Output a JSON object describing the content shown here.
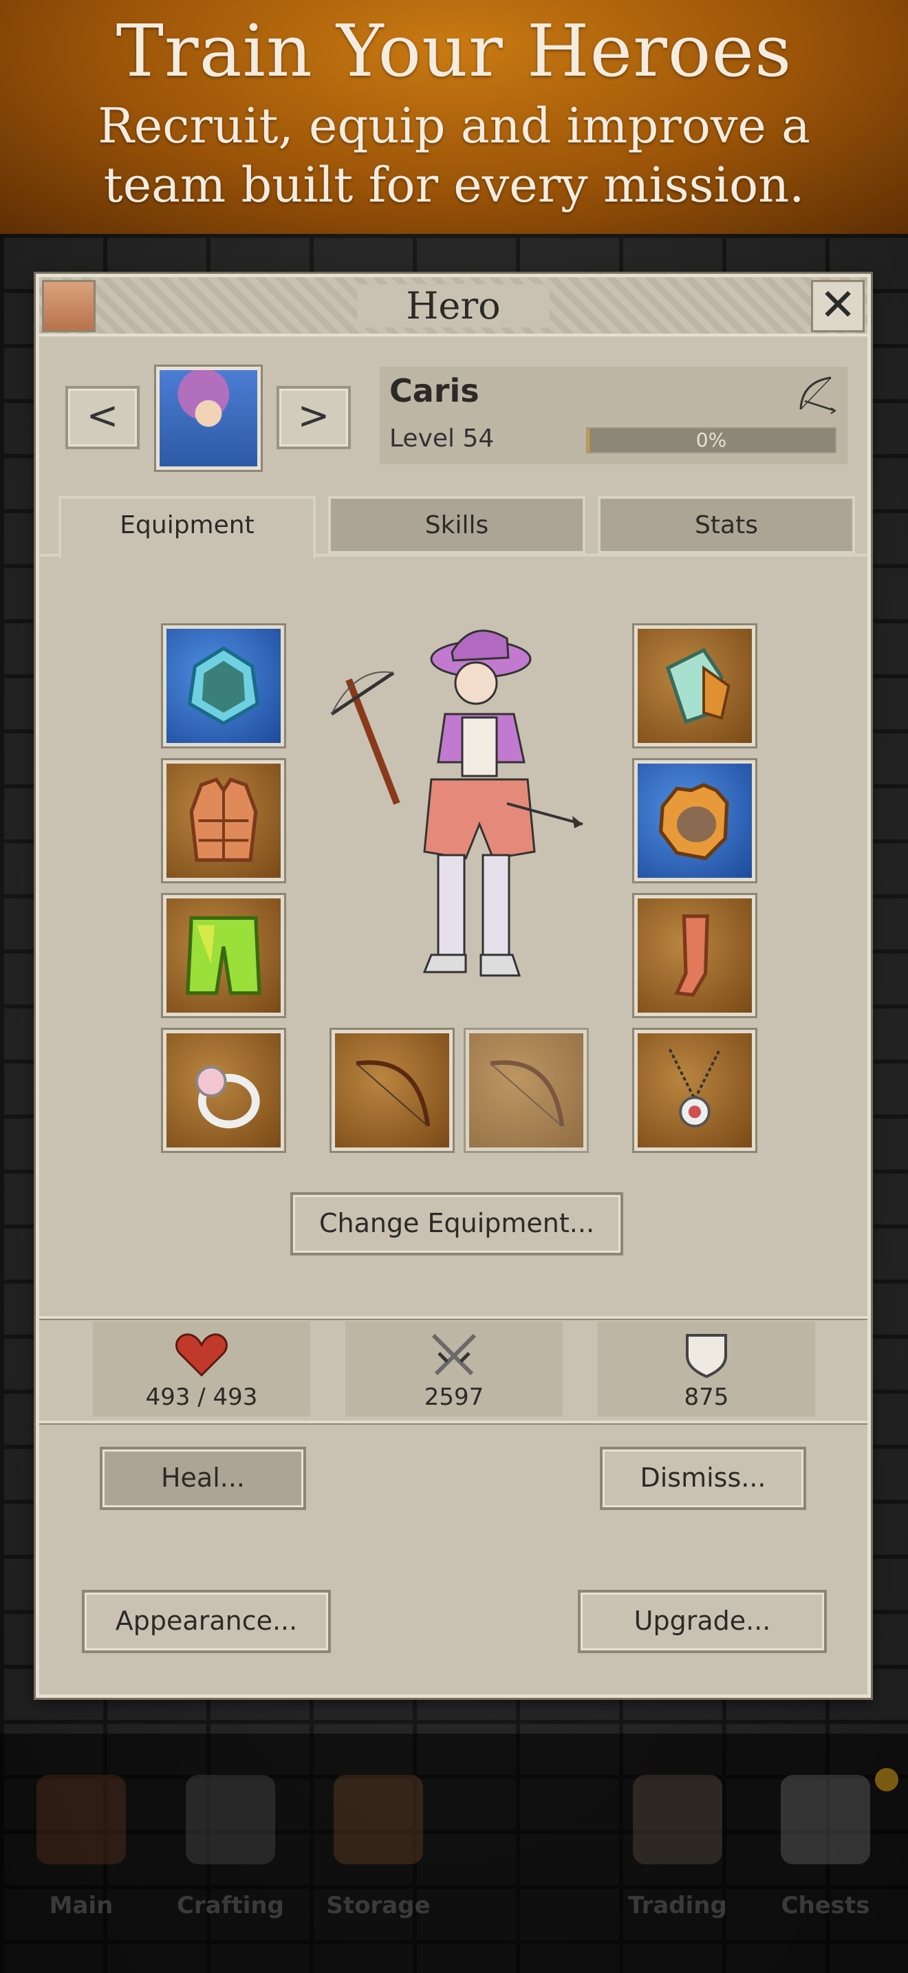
{
  "banner": {
    "title": "Train Your Heroes",
    "subtitle_line1": "Recruit, equip and improve a",
    "subtitle_line2": "team built for every mission."
  },
  "dialog": {
    "title": "Hero",
    "close_label": "✕"
  },
  "hero": {
    "name": "Caris",
    "level": "Level 54",
    "xp_percent": "0%",
    "xp_fraction": 0.0,
    "class_icon": "bow-icon",
    "prev_label": "<",
    "next_label": ">"
  },
  "tabs": [
    {
      "label": "Equipment",
      "active": true
    },
    {
      "label": "Skills",
      "active": false
    },
    {
      "label": "Stats",
      "active": false
    }
  ],
  "equipment": {
    "slots": [
      {
        "name": "helmet-slot",
        "icon": "crystal-helmet-icon"
      },
      {
        "name": "shoulder-slot",
        "icon": "shoulder-armor-icon"
      },
      {
        "name": "chest-slot",
        "icon": "leather-vest-icon"
      },
      {
        "name": "gloves-slot",
        "icon": "gloves-icon"
      },
      {
        "name": "legs-slot",
        "icon": "pants-icon"
      },
      {
        "name": "boots-slot",
        "icon": "boot-icon"
      },
      {
        "name": "ring-slot",
        "icon": "ring-icon"
      },
      {
        "name": "main-hand-slot",
        "icon": "bow-icon"
      },
      {
        "name": "off-hand-slot",
        "icon": "bow-icon"
      },
      {
        "name": "amulet-slot",
        "icon": "amulet-icon"
      }
    ],
    "change_button": "Change Equipment..."
  },
  "stats": {
    "health": "493 / 493",
    "attack": "2597",
    "defense": "875"
  },
  "actions": {
    "heal": "Heal...",
    "dismiss": "Dismiss...",
    "appearance": "Appearance...",
    "upgrade": "Upgrade..."
  },
  "bottom_nav": [
    {
      "label": "Main",
      "icon": "house-icon"
    },
    {
      "label": "Crafting",
      "icon": "hammer-icon"
    },
    {
      "label": "Storage",
      "icon": "backpack-icon"
    },
    {
      "label": "Trading",
      "icon": "trade-icon"
    },
    {
      "label": "Chests",
      "icon": "chest-icon"
    }
  ],
  "colors": {
    "banner": "#9a5308",
    "panel": "#c9c2b2",
    "xp_fill": "#d89a2a",
    "heart": "#c0392b"
  }
}
